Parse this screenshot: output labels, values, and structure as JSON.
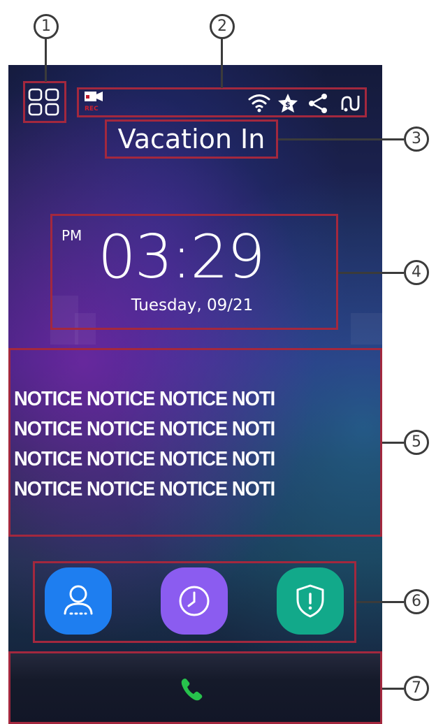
{
  "header": {
    "title": "Vacation In"
  },
  "clock": {
    "ampm": "PM",
    "time": "03:29",
    "date": "Tuesday,  09/21"
  },
  "notice": {
    "lines": [
      "NOTICE NOTICE NOTICE NOTI",
      "NOTICE NOTICE NOTICE NOTI",
      "NOTICE NOTICE NOTICE NOTI",
      "NOTICE NOTICE NOTICE NOTI"
    ]
  },
  "status_bar": {
    "icons": [
      "record-video-icon",
      "wifi-icon",
      "star-badge-icon",
      "share-icon",
      "connection-icon"
    ],
    "record_label": "REC"
  },
  "apps": [
    {
      "name": "contacts",
      "icon": "person-icon",
      "color": "#1e7ef0"
    },
    {
      "name": "history",
      "icon": "clock-icon",
      "color": "#8b5cf0"
    },
    {
      "name": "security",
      "icon": "shield-alert-icon",
      "color": "#12a98a"
    }
  ],
  "call": {
    "icon": "phone-icon",
    "color": "#27c24c"
  },
  "callouts": [
    "1",
    "2",
    "3",
    "4",
    "5",
    "6",
    "7"
  ]
}
